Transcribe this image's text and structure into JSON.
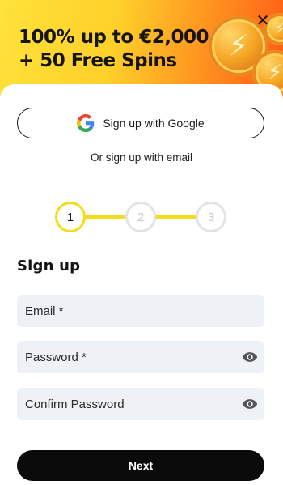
{
  "banner": {
    "line1": "100% up to €2,000",
    "line2": "+ 50 Free Spins",
    "close_label": "✕"
  },
  "google": {
    "label": "Sign up with Google"
  },
  "or_text": "Or sign up with email",
  "stepper": {
    "steps": [
      "1",
      "2",
      "3"
    ],
    "current": 1
  },
  "form": {
    "title": "Sign up",
    "email_placeholder": "Email *",
    "password_placeholder": "Password *",
    "confirm_placeholder": "Confirm Password"
  },
  "next_label": "Next",
  "colors": {
    "accent": "#f3dc1a",
    "button": "#0b0b0b",
    "field_bg": "#eef2f6"
  },
  "icons": {
    "close": "close-icon",
    "google": "google-icon",
    "eye": "eye-icon",
    "coin": "lightning-coin-icon"
  }
}
